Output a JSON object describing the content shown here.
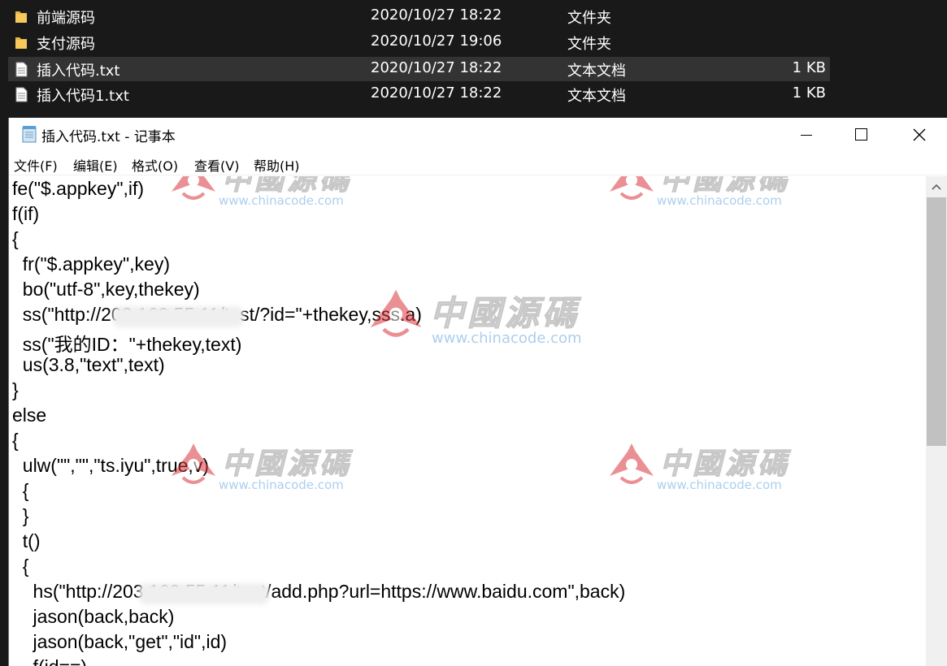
{
  "explorer": {
    "files": [
      {
        "name": "前端源码",
        "date": "2020/10/27 18:22",
        "type": "文件夹",
        "size": "",
        "icon": "folder-icon",
        "selected": false
      },
      {
        "name": "支付源码",
        "date": "2020/10/27 19:06",
        "type": "文件夹",
        "size": "",
        "icon": "folder-icon",
        "selected": false
      },
      {
        "name": "插入代码.txt",
        "date": "2020/10/27 18:22",
        "type": "文本文档",
        "size": "1 KB",
        "icon": "text-file-icon",
        "selected": true
      },
      {
        "name": "插入代码1.txt",
        "date": "2020/10/27 18:22",
        "type": "文本文档",
        "size": "1 KB",
        "icon": "text-file-icon",
        "selected": false
      }
    ]
  },
  "notepad": {
    "title": "插入代码.txt - 记事本",
    "icon": "notepad-icon",
    "menu": [
      "文件(F)",
      "编辑(E)",
      "格式(O)",
      "查看(V)",
      "帮助(H)"
    ],
    "controls": {
      "minimize": "minimize-icon",
      "maximize": "maximize-icon",
      "close": "close-icon"
    },
    "lines": [
      "fe(\"$.appkey\",if)",
      "f(if)",
      "{",
      "  fr(\"$.appkey\",key)",
      "  bo(\"utf-8\",key,thekey)",
      "  ss(\"http://203.160.55.11/test/?id=\"+thekey,sss.a)",
      "  ss(\"我的ID：\"+thekey,text)",
      "  us(3.8,\"text\",text)",
      "}",
      "else",
      "{",
      "  ulw(\"\",\"\",\"ts.iyu\",true,v)",
      "  {",
      "  }",
      "  t()",
      "  {",
      "    hs(\"http://203.160.55.11/test/add.php?url=https://www.baidu.com\",back)",
      "    jason(back,back)",
      "    jason(back,\"get\",\"id\",id)",
      "    f(id==)"
    ]
  },
  "watermark": {
    "text": "中國源碼",
    "url": "www.chinacode.com"
  },
  "colors": {
    "explorer_bg": "#191919",
    "selected_row": "#333333",
    "folder": "#e8b447",
    "watermark_red": "#d9363e",
    "watermark_blue": "#6aa7e0"
  }
}
